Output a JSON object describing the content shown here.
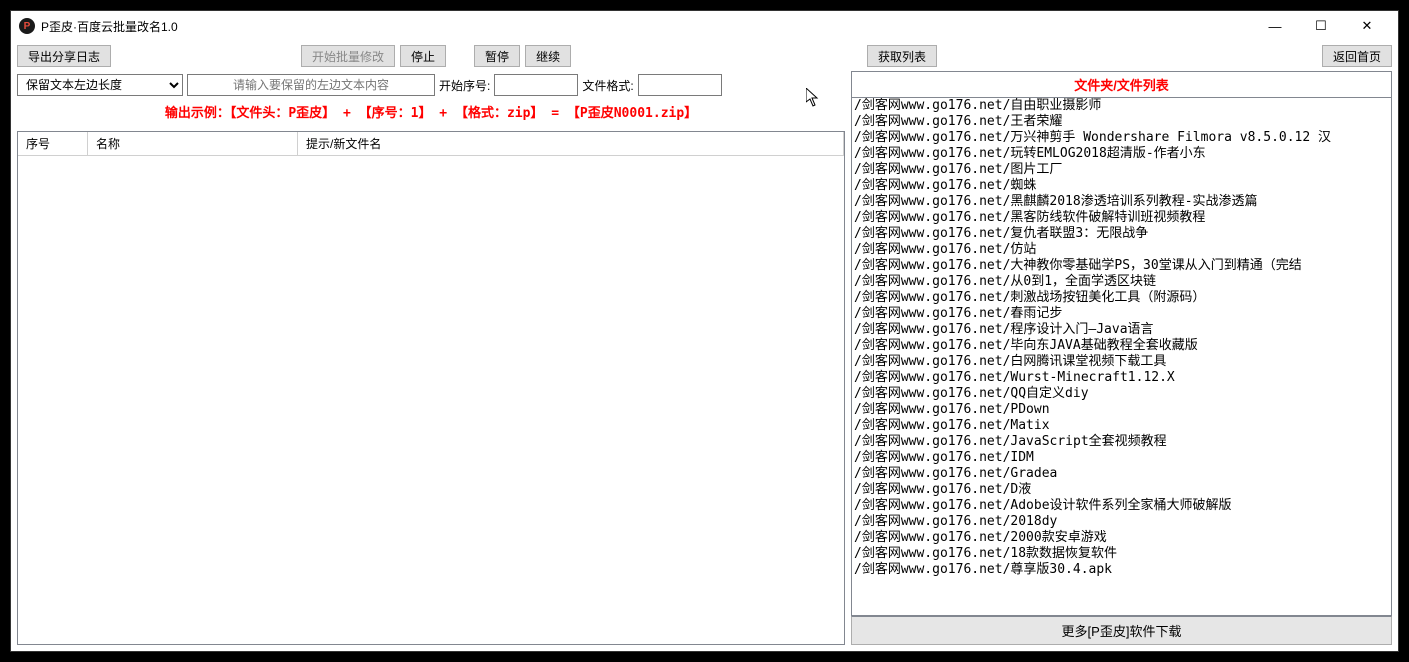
{
  "window": {
    "title": "P歪皮·百度云批量改名1.0"
  },
  "toolbar": {
    "export_log": "导出分享日志",
    "start_batch": "开始批量修改",
    "stop": "停止",
    "pause": "暂停",
    "continue": "继续",
    "get_list": "获取列表",
    "back_home": "返回首页"
  },
  "filter": {
    "select_option": "保留文本左边长度",
    "text_placeholder": "请输入要保留的左边文本内容",
    "start_seq_label": "开始序号:",
    "start_seq_value": "",
    "file_format_label": "文件格式:",
    "file_format_value": ""
  },
  "example_line": "输出示例：【文件头：P歪皮】 + 【序号：1】 + 【格式：zip】 = 【P歪皮N0001.zip】",
  "table": {
    "col_index": "序号",
    "col_name": "名称",
    "col_hint": "提示/新文件名"
  },
  "right": {
    "list_header": "文件夹/文件列表",
    "more_button": "更多[P歪皮]软件下载",
    "items": [
      "/剑客网www.go176.net/自由职业摄影师",
      "/剑客网www.go176.net/王者荣耀",
      "/剑客网www.go176.net/万兴神剪手 Wondershare Filmora v8.5.0.12 汉",
      "/剑客网www.go176.net/玩转EMLOG2018超清版-作者小东",
      "/剑客网www.go176.net/图片工厂",
      "/剑客网www.go176.net/蜘蛛",
      "/剑客网www.go176.net/黑麒麟2018渗透培训系列教程-实战渗透篇",
      "/剑客网www.go176.net/黑客防线软件破解特训班视频教程",
      "/剑客网www.go176.net/复仇者联盟3：无限战争",
      "/剑客网www.go176.net/仿站",
      "/剑客网www.go176.net/大神教你零基础学PS，30堂课从入门到精通（完结",
      "/剑客网www.go176.net/从0到1，全面学透区块链",
      "/剑客网www.go176.net/刺激战场按钮美化工具（附源码）",
      "/剑客网www.go176.net/春雨记步",
      "/剑客网www.go176.net/程序设计入门—Java语言",
      "/剑客网www.go176.net/毕向东JAVA基础教程全套收藏版",
      "/剑客网www.go176.net/白网腾讯课堂视频下载工具",
      "/剑客网www.go176.net/Wurst-Minecraft1.12.X",
      "/剑客网www.go176.net/QQ自定义diy",
      "/剑客网www.go176.net/PDown",
      "/剑客网www.go176.net/Matix",
      "/剑客网www.go176.net/JavaScript全套视频教程",
      "/剑客网www.go176.net/IDM",
      "/剑客网www.go176.net/Gradea",
      "/剑客网www.go176.net/D液",
      "/剑客网www.go176.net/Adobe设计软件系列全家桶大师破解版",
      "/剑客网www.go176.net/2018dy",
      "/剑客网www.go176.net/2000款安卓游戏",
      "/剑客网www.go176.net/18款数据恢复软件",
      "/剑客网www.go176.net/尊享版30.4.apk"
    ]
  }
}
